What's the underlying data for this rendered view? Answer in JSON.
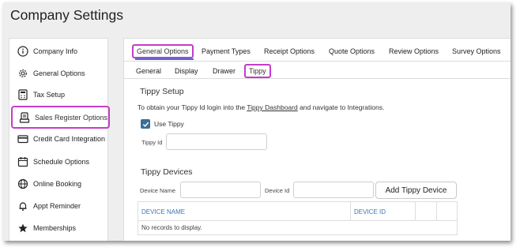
{
  "app": {
    "title": "Company Settings"
  },
  "sidebar": {
    "items": [
      {
        "label": "Company Info",
        "icon": "info-icon"
      },
      {
        "label": "General Options",
        "icon": "gear-icon"
      },
      {
        "label": "Tax Setup",
        "icon": "calculator-icon"
      },
      {
        "label": "Sales Register Options",
        "icon": "register-icon",
        "highlighted": true
      },
      {
        "label": "Credit Card Integration",
        "icon": "credit-card-icon"
      },
      {
        "label": "Schedule Options",
        "icon": "calendar-icon"
      },
      {
        "label": "Online Booking",
        "icon": "globe-icon"
      },
      {
        "label": "Appt Reminder",
        "icon": "bell-icon"
      },
      {
        "label": "Memberships",
        "icon": "star-icon"
      }
    ]
  },
  "tabs": {
    "top": [
      "General Options",
      "Payment Types",
      "Receipt Options",
      "Quote Options",
      "Review Options",
      "Survey Options"
    ],
    "active_top": "General Options",
    "sub": [
      "General",
      "Display",
      "Drawer",
      "Tippy"
    ],
    "active_sub": "Tippy"
  },
  "tippy_setup": {
    "title": "Tippy Setup",
    "info_prefix": "To obtain your Tippy Id login into the ",
    "info_link": "Tippy Dashboard",
    "info_suffix": " and navigate to Integrations.",
    "use_tippy_label": "Use Tippy",
    "use_tippy_checked": true,
    "tippy_id_label": "Tippy Id",
    "tippy_id_value": ""
  },
  "tippy_devices": {
    "title": "Tippy Devices",
    "device_name_label": "Device Name",
    "device_name_value": "",
    "device_id_label": "Device Id",
    "device_id_value": "",
    "add_button": "Add Tippy Device",
    "columns": [
      "DEVICE NAME",
      "DEVICE ID",
      "",
      ""
    ],
    "empty_message": "No records to display."
  },
  "colors": {
    "highlight": "#c43cc8",
    "accent": "#2e7bd6",
    "header_text": "#3a78b4",
    "checkbox": "#3b6e96"
  }
}
